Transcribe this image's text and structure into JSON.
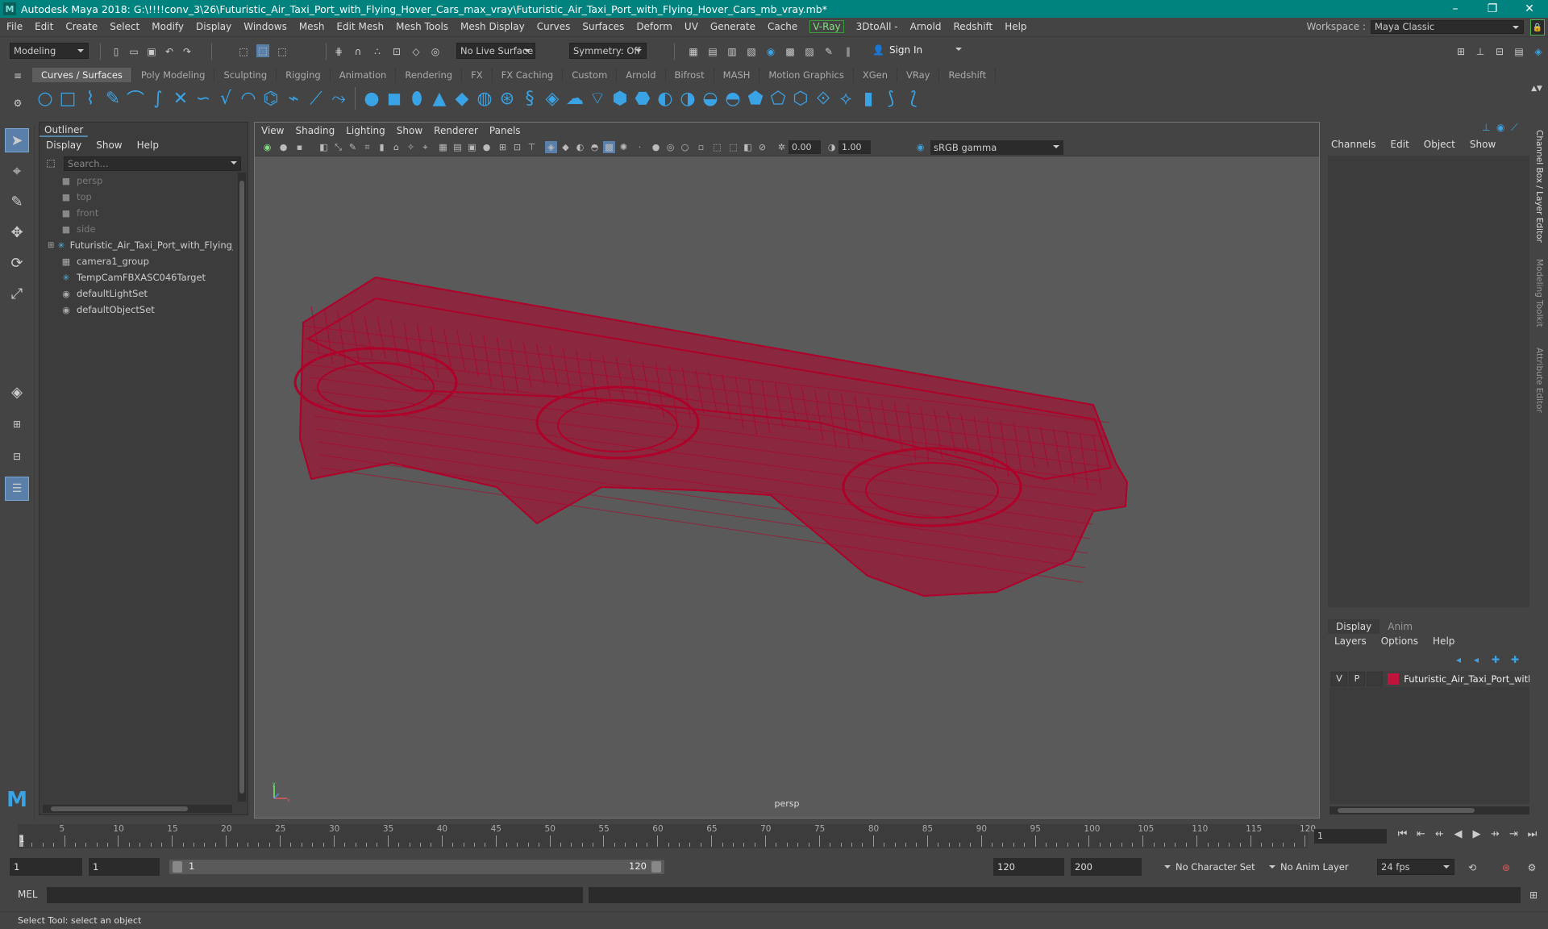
{
  "window": {
    "title": "Autodesk Maya 2018: G:\\!!!!conv_3\\26\\Futuristic_Air_Taxi_Port_with_Flying_Hover_Cars_max_vray\\Futuristic_Air_Taxi_Port_with_Flying_Hover_Cars_mb_vray.mb*",
    "controls": [
      "–",
      "❐",
      "✕"
    ]
  },
  "menubar": {
    "items": [
      "File",
      "Edit",
      "Create",
      "Select",
      "Modify",
      "Display",
      "Windows",
      "Mesh",
      "Edit Mesh",
      "Mesh Tools",
      "Mesh Display",
      "Curves",
      "Surfaces",
      "Deform",
      "UV",
      "Generate",
      "Cache",
      "V-Ray",
      "3DtoAll -",
      "Arnold",
      "Redshift",
      "Help"
    ],
    "workspace_label": "Workspace :",
    "workspace_value": "Maya Classic"
  },
  "statusline": {
    "mode": "Modeling",
    "live_surface": "No Live Surface",
    "symmetry": "Symmetry: Off",
    "sign_in": "Sign In"
  },
  "shelf": {
    "tabs": [
      "Curves / Surfaces",
      "Poly Modeling",
      "Sculpting",
      "Rigging",
      "Animation",
      "Rendering",
      "FX",
      "FX Caching",
      "Custom",
      "Arnold",
      "Bifrost",
      "MASH",
      "Motion Graphics",
      "XGen",
      "VRay",
      "Redshift"
    ],
    "active_tab": "Curves / Surfaces"
  },
  "outliner": {
    "title": "Outliner",
    "menu": [
      "Display",
      "Show",
      "Help"
    ],
    "search_placeholder": "Search...",
    "items": [
      {
        "label": "persp",
        "icon": "camera-icon",
        "dim": true
      },
      {
        "label": "top",
        "icon": "camera-icon",
        "dim": true
      },
      {
        "label": "front",
        "icon": "camera-icon",
        "dim": true
      },
      {
        "label": "side",
        "icon": "camera-icon",
        "dim": true
      },
      {
        "label": "Futuristic_Air_Taxi_Port_with_Flying_H",
        "icon": "transform-icon",
        "dim": false,
        "expandable": true
      },
      {
        "label": "camera1_group",
        "icon": "group-icon",
        "dim": false
      },
      {
        "label": "TempCamFBXASC046Target",
        "icon": "transform-icon",
        "dim": false
      },
      {
        "label": "defaultLightSet",
        "icon": "set-icon",
        "dim": false
      },
      {
        "label": "defaultObjectSet",
        "icon": "set-icon",
        "dim": false
      }
    ]
  },
  "viewport": {
    "menu": [
      "View",
      "Shading",
      "Lighting",
      "Show",
      "Renderer",
      "Panels"
    ],
    "exposure": "0.00",
    "gamma": "1.00",
    "color_space": "sRGB gamma",
    "camera_label": "persp",
    "wire_color": "#b0002a"
  },
  "channelbox": {
    "menu": [
      "Channels",
      "Edit",
      "Object",
      "Show"
    ]
  },
  "sidetabs": [
    "Channel Box / Layer Editor",
    "Modeling Toolkit",
    "Attribute Editor"
  ],
  "layers": {
    "tabs": [
      "Display",
      "Anim"
    ],
    "menu": [
      "Layers",
      "Options",
      "Help"
    ],
    "layer": {
      "v": "V",
      "p": "P",
      "name": "Futuristic_Air_Taxi_Port_with_F",
      "color": "#c0143c"
    }
  },
  "timeline": {
    "ticks": [
      5,
      10,
      15,
      20,
      25,
      30,
      35,
      40,
      45,
      50,
      55,
      60,
      65,
      70,
      75,
      80,
      85,
      90,
      95,
      100,
      105,
      110,
      115,
      120
    ],
    "current_frame": "1",
    "frame_field": "1"
  },
  "range": {
    "start": "1",
    "playback_start": "1",
    "slider_start": "1",
    "slider_end": "120",
    "playback_end": "120",
    "end": "200",
    "character_set": "No Character Set",
    "anim_layer": "No Anim Layer",
    "fps": "24 fps"
  },
  "mel": {
    "label": "MEL"
  },
  "helpline": {
    "text": "Select Tool: select an object"
  }
}
